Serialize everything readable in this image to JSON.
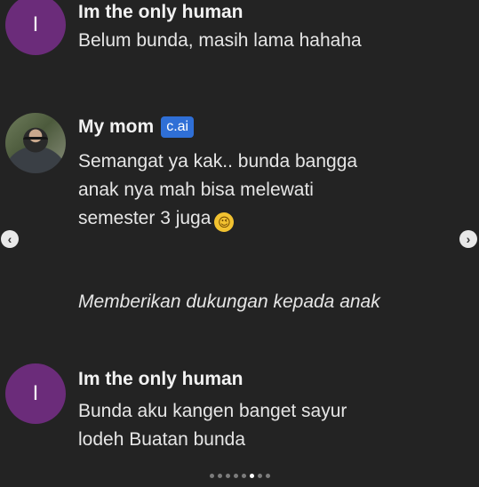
{
  "messages": [
    {
      "avatar_letter": "I",
      "name": "Im the only human",
      "text": "Belum bunda, masih lama hahaha"
    },
    {
      "name": "My mom",
      "badge": "c.ai",
      "text_lines": [
        "Semangat ya kak.. bunda bangga",
        "anak nya mah bisa melewati",
        "semester 3 juga"
      ],
      "emoji": "😉"
    },
    {
      "avatar_letter": "I",
      "name": "Im the only human",
      "text_lines": [
        "Bunda aku kangen banget sayur",
        "lodeh Buatan bunda"
      ]
    }
  ],
  "caption": "Memberikan dukungan kepada anak",
  "nav": {
    "prev": "‹",
    "next": "›"
  },
  "carousel": {
    "total": 8,
    "active_index": 5
  }
}
